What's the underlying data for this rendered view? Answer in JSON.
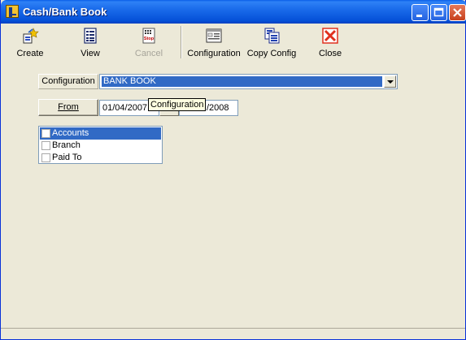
{
  "window": {
    "title": "Cash/Bank Book",
    "colors": {
      "title_bar": "#0A5FE8",
      "selection": "#316AC5",
      "face": "#ECE9D8",
      "close": "#E0301E"
    }
  },
  "toolbar": {
    "items": [
      {
        "label": "Create",
        "icon": "create-icon",
        "enabled": true
      },
      {
        "label": "View",
        "icon": "view-icon",
        "enabled": true
      },
      {
        "label": "Cancel",
        "icon": "stop-icon",
        "icon_text": "Stop",
        "enabled": false
      },
      {
        "label": "Configuration",
        "icon": "configuration-icon",
        "enabled": true
      },
      {
        "label": "Copy Config",
        "icon": "copy-config-icon",
        "enabled": true
      },
      {
        "label": "Close",
        "icon": "close-icon",
        "enabled": true
      }
    ]
  },
  "form": {
    "configuration_label": "Configuration",
    "configuration_value": "BANK BOOK",
    "from_button": "From",
    "from_date": "01/04/2007",
    "to_date_visible": "/2008",
    "tooltip": "Configuration"
  },
  "filters": {
    "items": [
      {
        "label": "Accounts",
        "selected": true,
        "checked": false
      },
      {
        "label": "Branch",
        "selected": false,
        "checked": false
      },
      {
        "label": "Paid To",
        "selected": false,
        "checked": false
      }
    ]
  }
}
